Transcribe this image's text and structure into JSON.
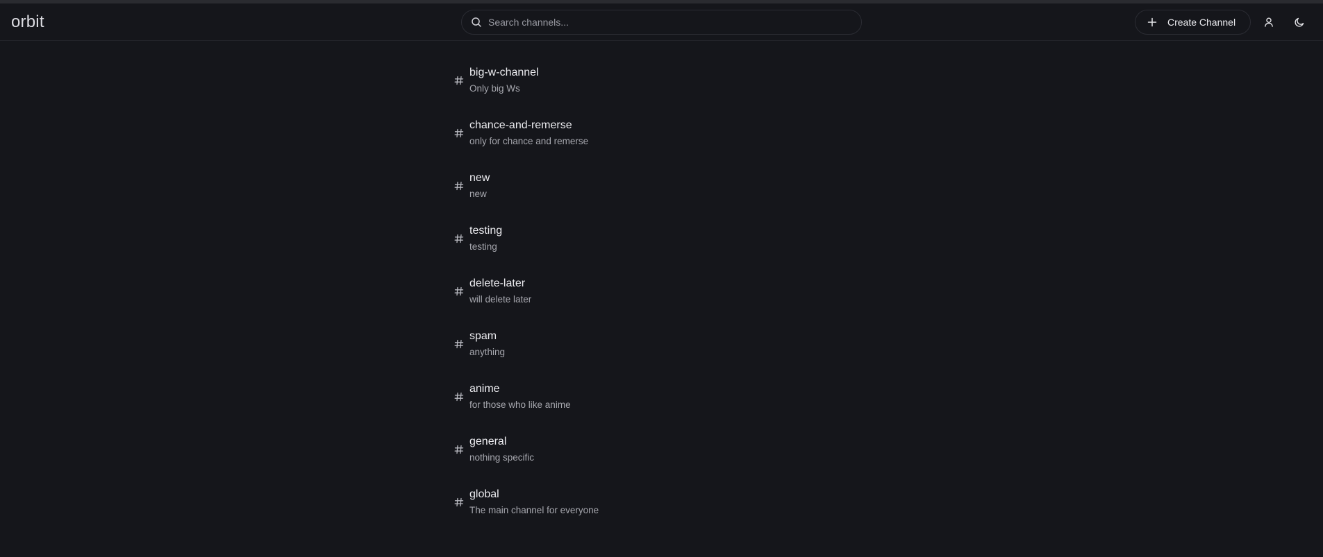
{
  "app": {
    "logo": "orbit"
  },
  "search": {
    "placeholder": "Search channels..."
  },
  "header": {
    "create_label": "Create Channel"
  },
  "icons": {
    "search": "search-icon",
    "create": "plus-icon",
    "user": "user-icon",
    "theme": "moon-icon",
    "channel": "hash-icon"
  },
  "colors": {
    "background": "#15161b",
    "border": "#2b2c33",
    "text_primary": "#ececf0",
    "text_secondary": "#a6a7ae"
  },
  "channels": [
    {
      "name": "big-w-channel",
      "description": "Only big Ws"
    },
    {
      "name": "chance-and-remerse",
      "description": "only for chance and remerse"
    },
    {
      "name": "new",
      "description": "new"
    },
    {
      "name": "testing",
      "description": "testing"
    },
    {
      "name": "delete-later",
      "description": "will delete later"
    },
    {
      "name": "spam",
      "description": "anything"
    },
    {
      "name": "anime",
      "description": "for those who like anime"
    },
    {
      "name": "general",
      "description": "nothing specific"
    },
    {
      "name": "global",
      "description": "The main channel for everyone"
    }
  ]
}
